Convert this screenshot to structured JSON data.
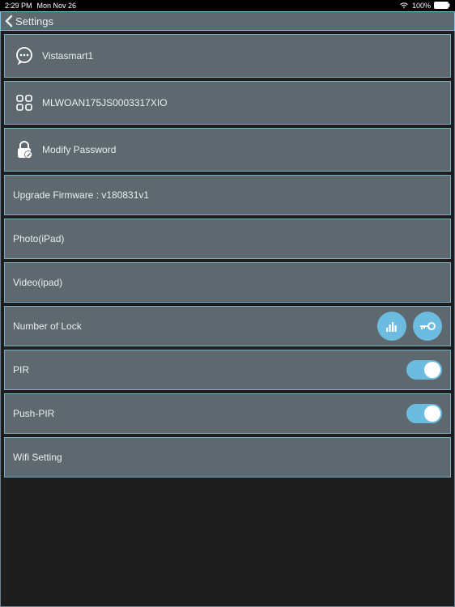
{
  "status": {
    "time": "2:29 PM",
    "date": "Mon Nov 26",
    "battery_percent": "100%"
  },
  "nav": {
    "back_label": "Settings"
  },
  "rows": {
    "device_name": "Vistasmart1",
    "device_id": "MLWOAN175JS0003317XIO",
    "modify_password": "Modify Password",
    "upgrade_firmware": "Upgrade Firmware : v180831v1",
    "photo": "Photo(iPad)",
    "video": "Video(ipad)",
    "number_of_lock": "Number of Lock",
    "pir": "PIR",
    "push_pir": "Push-PIR",
    "wifi_setting": "Wifi Setting"
  },
  "toggles": {
    "pir": true,
    "push_pir": true
  },
  "icons": {
    "device_name": "speech-ellipsis-icon",
    "device_id": "grid-icon",
    "modify_password": "lock-edit-icon",
    "lock_stats": "bars-icon",
    "lock_key": "key-icon"
  }
}
